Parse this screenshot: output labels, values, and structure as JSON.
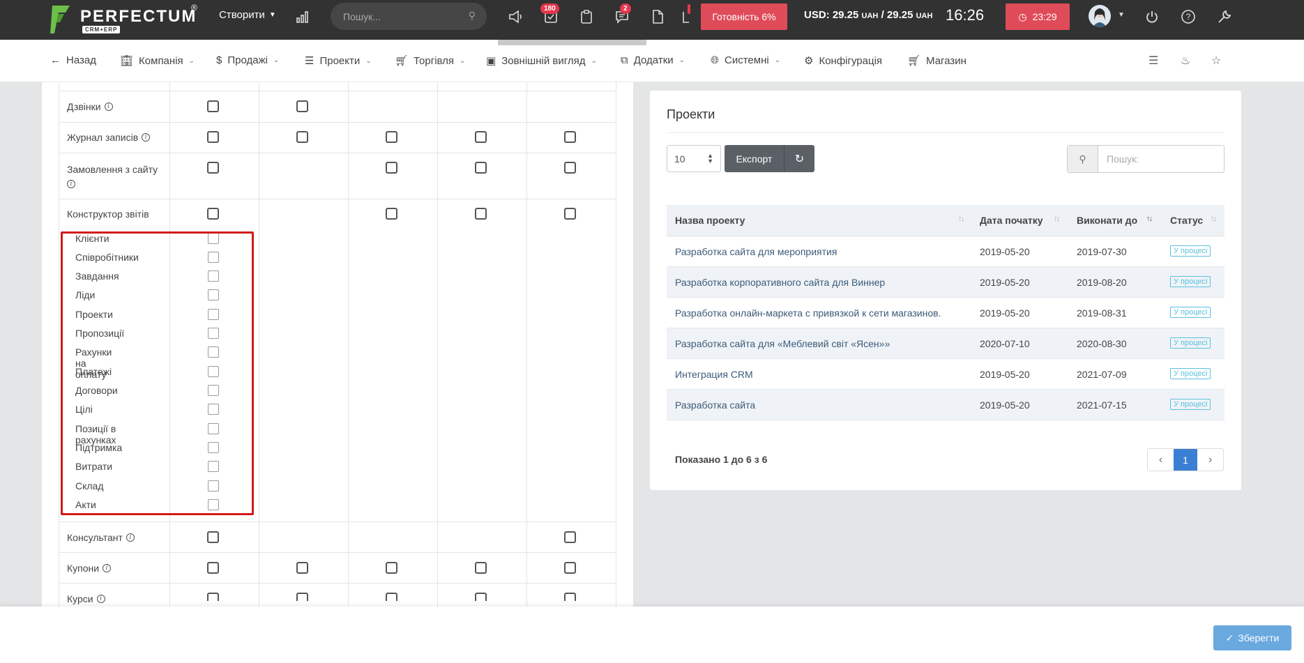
{
  "topbar": {
    "brand": "PERFECTUM",
    "brand_reg": "®",
    "brand_sub": "CRM+ERP",
    "create_label": "Створити",
    "search_placeholder": "Пошук...",
    "tasks_badge": "180",
    "chat_badge": "2",
    "ready_label": "Готовність 6%",
    "usd_rate": "USD: 29.25",
    "usd_unit": "UAH",
    "usd_sep": "/ 29.25",
    "usd_unit2": "UAH",
    "clock": "16:26",
    "timer": "23:29",
    "icons": [
      "megaphone-icon",
      "tasks-icon",
      "clipboard-icon",
      "chat-icon",
      "file-icon",
      "power-icon",
      "help-icon",
      "wrench-icon"
    ]
  },
  "nav": {
    "back": "Назад",
    "companies": "Компанія",
    "sales": "Продажі",
    "projects": "Проекти",
    "trade": "Торгівля",
    "appearance": "Зовнішній вигляд",
    "addons": "Додатки",
    "system": "Системні",
    "config": "Конфігурація",
    "shop": "Магазин"
  },
  "permissions": {
    "rows": [
      {
        "label": "Дзвінки",
        "info": true
      },
      {
        "label": "Журнал записів",
        "info": true
      },
      {
        "label": "Замовлення з сайту",
        "info": true
      },
      {
        "label": "Конструктор звітів",
        "info": false
      },
      {
        "label": "Консультант",
        "info": true
      },
      {
        "label": "Купони",
        "info": true
      },
      {
        "label": "Курси",
        "info": true
      }
    ],
    "sub_items": [
      "Клієнти",
      "Співробітники",
      "Завдання",
      "Ліди",
      "Проекти",
      "Пропозиції",
      "Рахунки на оплату",
      "Платежі",
      "Договори",
      "Цілі",
      "Позиції в рахунках",
      "Підтримка",
      "Витрати",
      "Склад",
      "Акти"
    ]
  },
  "projects_card": {
    "title": "Проекти",
    "page_size": "10",
    "export_label": "Експорт",
    "search_placeholder": "Пошук:",
    "columns": [
      "Назва проекту",
      "Дата початку",
      "Виконати до",
      "Статус"
    ],
    "rows": [
      {
        "name": "Разработка сайта для мероприятия",
        "start": "2019-05-20",
        "due": "2019-07-30",
        "status": "У процесі"
      },
      {
        "name": "Разработка корпоративного сайта для Виннер",
        "start": "2019-05-20",
        "due": "2019-08-20",
        "status": "У процесі"
      },
      {
        "name": "Разработка онлайн-маркета с привязкой к сети магазинов.",
        "start": "2019-05-20",
        "due": "2019-08-31",
        "status": "У процесі"
      },
      {
        "name": "Разработка сайта для «Меблевий світ «Ясен»»",
        "start": "2020-07-10",
        "due": "2020-08-30",
        "status": "У процесі"
      },
      {
        "name": "Интеграция CRM",
        "start": "2019-05-20",
        "due": "2021-07-09",
        "status": "У процесі"
      },
      {
        "name": "Разработка сайта",
        "start": "2019-05-20",
        "due": "2021-07-15",
        "status": "У процесі"
      }
    ],
    "shown_text": "Показано 1 до 6 з 6",
    "current_page": "1"
  },
  "footer": {
    "save_label": "Зберегти"
  },
  "colors": {
    "topbar": "#323232",
    "accent_red": "#e04b5a",
    "badge": "#e6374d",
    "primary_blue": "#3b7fd4",
    "status_info": "#5bc0de",
    "highlight_box": "#d21a1a"
  }
}
